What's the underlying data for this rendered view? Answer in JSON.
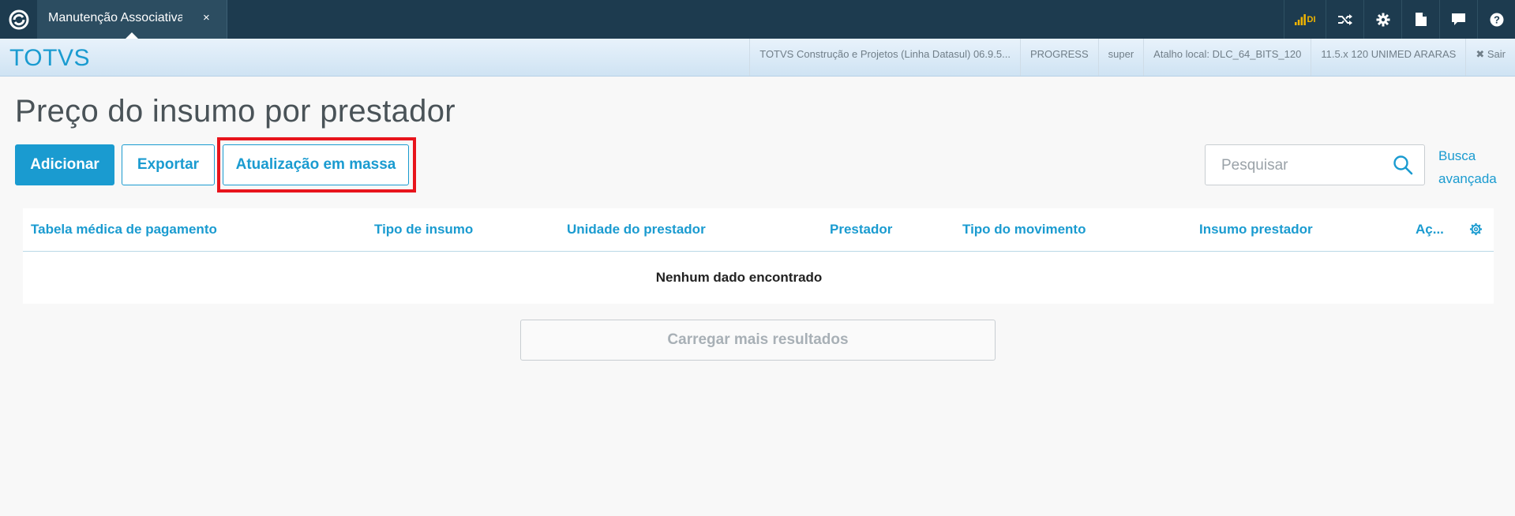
{
  "topbar": {
    "tab_label": "Manutenção Associativa",
    "tab_close": "×",
    "signal_text": "DI"
  },
  "header": {
    "brand": "TOTVS",
    "info": [
      "TOTVS Construção e Projetos (Linha Datasul) 06.9.5...",
      "PROGRESS",
      "super",
      "Atalho local: DLC_64_BITS_120",
      "11.5.x 120 UNIMED ARARAS"
    ],
    "logout_label": "Sair"
  },
  "page": {
    "title": "Preço do insumo por prestador"
  },
  "toolbar": {
    "add_label": "Adicionar",
    "export_label": "Exportar",
    "mass_update_label": "Atualização em massa"
  },
  "search": {
    "placeholder": "Pesquisar",
    "advanced_line1": "Busca",
    "advanced_line2": "avançada"
  },
  "table": {
    "columns": [
      "Tabela médica de pagamento",
      "Tipo de insumo",
      "Unidade do prestador",
      "Prestador",
      "Tipo do movimento",
      "Insumo prestador",
      "Aç..."
    ],
    "empty_message": "Nenhum dado encontrado"
  },
  "load_more_label": "Carregar mais resultados",
  "colors": {
    "topbar_bg": "#1d3b4f",
    "accent": "#1a9bd0",
    "highlight": "#e8141c",
    "signal": "#f0b400"
  }
}
